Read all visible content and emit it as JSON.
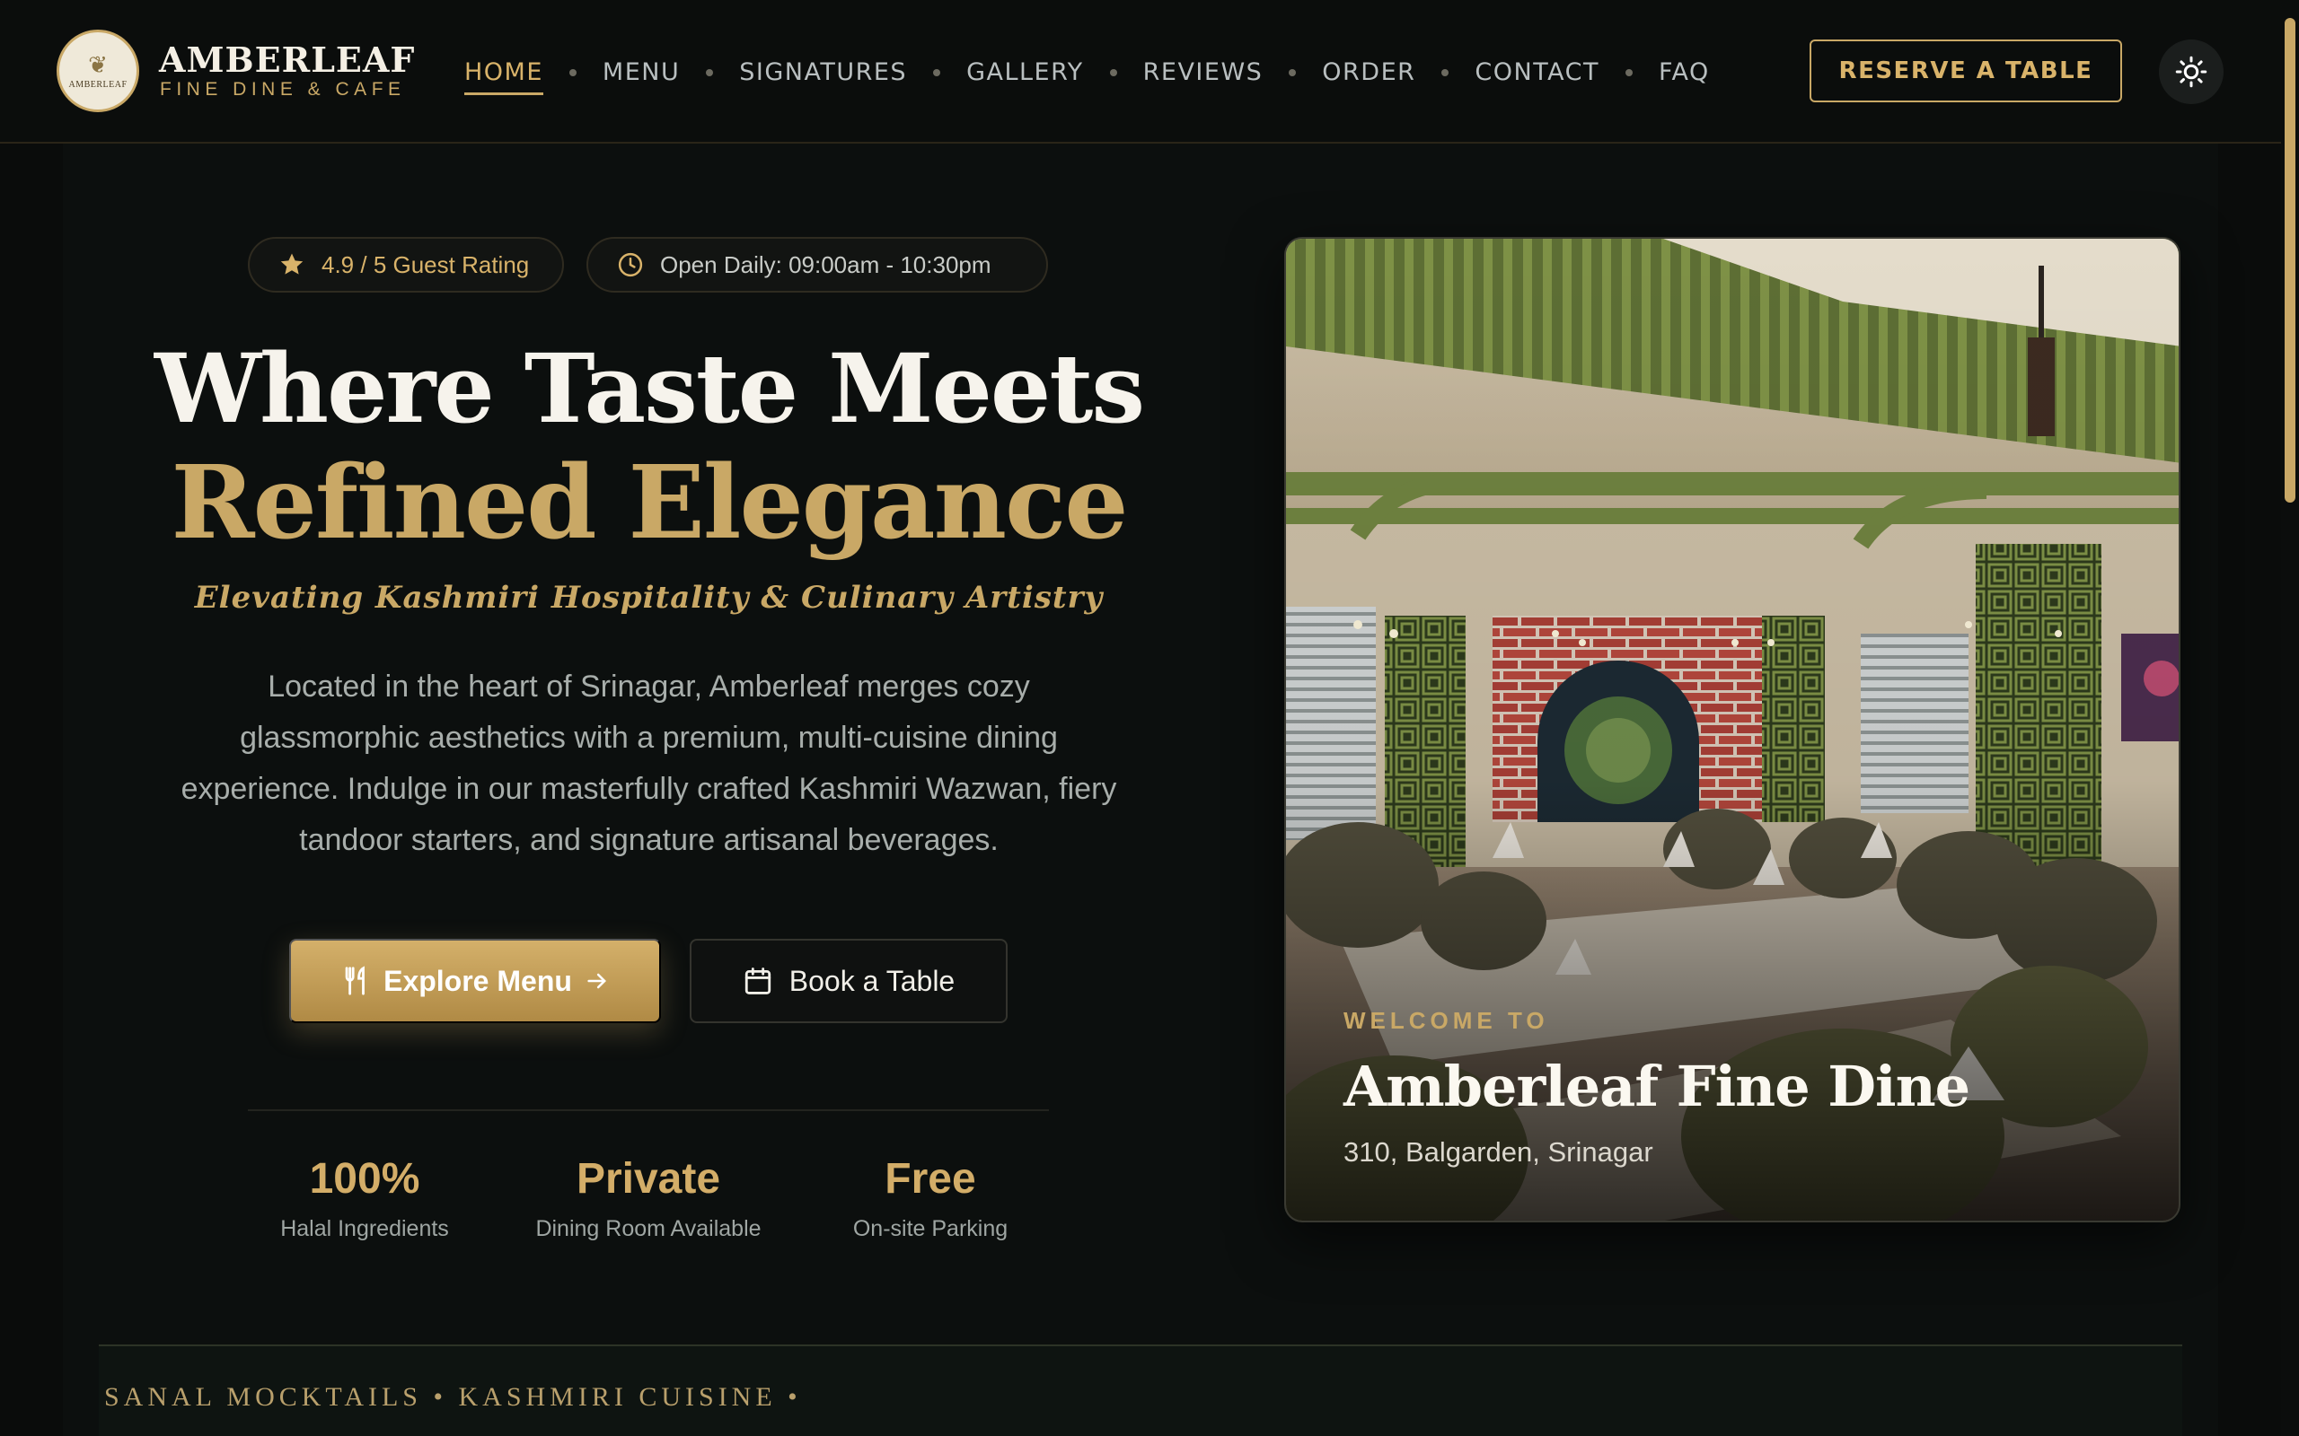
{
  "brand": {
    "name": "AMBERLEAF",
    "subtitle": "FINE DINE & CAFE",
    "badge_text": "AMBERLEAF"
  },
  "nav": {
    "items": [
      {
        "label": "HOME",
        "active": true
      },
      {
        "label": "MENU"
      },
      {
        "label": "SIGNATURES"
      },
      {
        "label": "GALLERY"
      },
      {
        "label": "REVIEWS"
      },
      {
        "label": "ORDER"
      },
      {
        "label": "CONTACT"
      },
      {
        "label": "FAQ"
      }
    ],
    "reserve_label": "RESERVE A TABLE",
    "theme_icon": "sun-icon"
  },
  "hero": {
    "rating_pill": "4.9 / 5 Guest Rating",
    "hours_pill": "Open Daily: 09:00am - 10:30pm",
    "heading_line1": "Where Taste Meets",
    "heading_line2": "Refined Elegance",
    "tagline": "Elevating Kashmiri Hospitality & Culinary Artistry",
    "description_lines": [
      "Located in the heart of Srinagar, Amberleaf merges cozy",
      "glassmorphic aesthetics with a premium, multi-cuisine dining",
      "experience. Indulge in our masterfully crafted Kashmiri Wazwan, fiery",
      "tandoor starters, and signature artisanal beverages."
    ],
    "explore_label": "Explore Menu",
    "book_label": "Book a Table",
    "stats": [
      {
        "value": "100%",
        "label": "Halal Ingredients"
      },
      {
        "value": "Private",
        "label": "Dining Room Available"
      },
      {
        "value": "Free",
        "label": "On-site Parking"
      }
    ]
  },
  "card": {
    "kicker": "WELCOME TO",
    "title": "Amberleaf Fine Dine",
    "address": "310, Balgarden, Srinagar"
  },
  "marquee": {
    "text": "SANAL MOCKTAILS  •  KASHMIRI CUISINE  •"
  },
  "colors": {
    "accent": "#c9a866",
    "background": "#0a0c0b",
    "text": "#f6f3ec"
  }
}
